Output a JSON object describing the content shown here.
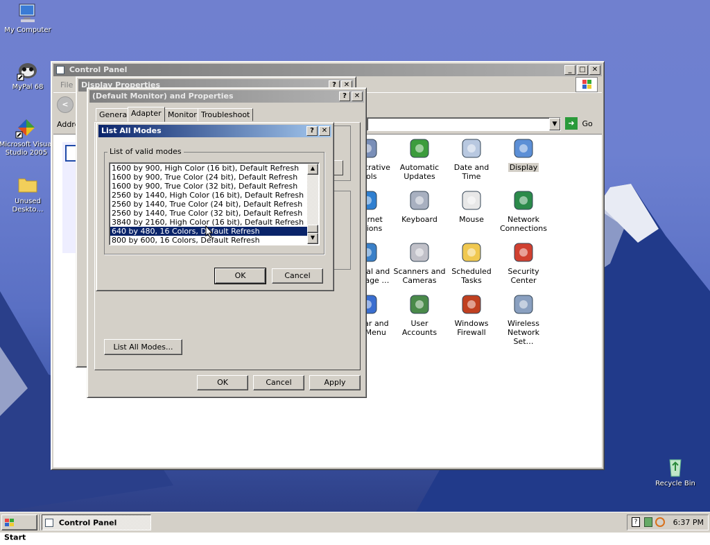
{
  "desktop": {
    "icons": [
      {
        "label": "My Computer",
        "icon": "my-computer-icon"
      },
      {
        "label": "MyPal 68",
        "icon": "raccoon-browser-icon"
      },
      {
        "label": "Microsoft Visual Studio 2005",
        "icon": "visual-studio-icon"
      },
      {
        "label": "Unused Deskto…",
        "icon": "folder-icon"
      },
      {
        "label": "Recycle Bin",
        "icon": "recycle-bin-icon"
      }
    ]
  },
  "control_panel": {
    "title": "Control Panel",
    "menu_file": "File",
    "address_label": "Addre",
    "go_label": "Go",
    "items": [
      {
        "label": "ministrative Tools",
        "icon": "admin-tools-icon"
      },
      {
        "label": "Automatic Updates",
        "icon": "windows-update-icon"
      },
      {
        "label": "Date and Time",
        "icon": "clock-icon"
      },
      {
        "label": "Display",
        "icon": "display-icon"
      },
      {
        "label": "Internet Options",
        "icon": "globe-icon"
      },
      {
        "label": "Keyboard",
        "icon": "keyboard-icon"
      },
      {
        "label": "Mouse",
        "icon": "mouse-icon"
      },
      {
        "label": "Network Connections",
        "icon": "network-icon"
      },
      {
        "label": "egional and anguage …",
        "icon": "globe-clock-icon"
      },
      {
        "label": "Scanners and Cameras",
        "icon": "scanner-icon"
      },
      {
        "label": "Scheduled Tasks",
        "icon": "folder-clock-icon"
      },
      {
        "label": "Security Center",
        "icon": "shield-icon"
      },
      {
        "label": "askbar and tart Menu",
        "icon": "taskbar-icon"
      },
      {
        "label": "User Accounts",
        "icon": "users-icon"
      },
      {
        "label": "Windows Firewall",
        "icon": "firewall-icon"
      },
      {
        "label": "Wireless Network Set…",
        "icon": "wireless-icon"
      }
    ]
  },
  "display_properties": {
    "title": "Display Properties"
  },
  "monitor_properties": {
    "title": "(Default Monitor) and  Properties",
    "tabs": [
      "General",
      "Adapter",
      "Monitor",
      "Troubleshoot"
    ],
    "active_tab": "Adapter",
    "list_all_modes_button": "List All Modes...",
    "ok": "OK",
    "cancel": "Cancel",
    "apply": "Apply"
  },
  "list_all_modes": {
    "title": "List All Modes",
    "group_label": "List of valid modes",
    "modes": [
      "1600 by 900, High Color (16 bit), Default Refresh",
      "1600 by 900, True Color (24 bit), Default Refresh",
      "1600 by 900, True Color (32 bit), Default Refresh",
      "2560 by 1440, High Color (16 bit), Default Refresh",
      "2560 by 1440, True Color (24 bit), Default Refresh",
      "2560 by 1440, True Color (32 bit), Default Refresh",
      "3840 by 2160, High Color (16 bit), Default Refresh",
      "640 by 480, 16 Colors, Default Refresh",
      "800 by 600, 16 Colors, Default Refresh"
    ],
    "selected_mode": "640 by 480, 16 Colors, Default Refresh",
    "ok": "OK",
    "cancel": "Cancel"
  },
  "taskbar": {
    "start": "Start",
    "task": "Control Panel",
    "clock": "6:37 PM"
  },
  "colors": {
    "titlebar_active": "#0a246a",
    "titlebar_inactive": "#808080",
    "face": "#d4d0c8",
    "selection": "#0a246a"
  }
}
